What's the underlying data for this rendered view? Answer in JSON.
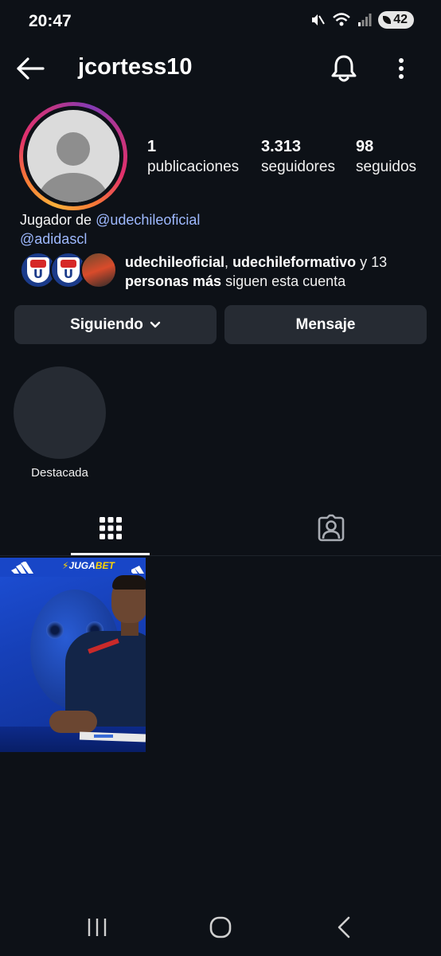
{
  "status_bar": {
    "time": "20:47",
    "battery": "42"
  },
  "profile": {
    "username": "jcortess10",
    "stats": [
      {
        "value": "1",
        "label": "publicaciones"
      },
      {
        "value": "3.313",
        "label": "seguidores"
      },
      {
        "value": "98",
        "label": "seguidos"
      }
    ],
    "bio": {
      "prefix": "Jugador de ",
      "mention_1": "@udechileoficial",
      "mention_2": "@adidascl"
    },
    "followed_by": {
      "name_1": "udechileoficial",
      "separator": ", ",
      "name_2": "udechileformativo",
      "connector": " y 13",
      "others": "personas más",
      "suffix": " siguen esta cuenta"
    }
  },
  "actions": {
    "following_label": "Siguiendo",
    "message_label": "Mensaje"
  },
  "highlights": [
    {
      "label": "Destacada"
    }
  ],
  "post": {
    "sponsor_prefix": "JUGA",
    "sponsor_suffix": "BET"
  },
  "icons": {
    "back": "arrow-left-icon",
    "notifications": "bell-icon",
    "more": "more-vertical-icon",
    "dropdown": "chevron-down-icon",
    "grid_tab": "grid-icon",
    "tagged_tab": "tagged-person-icon",
    "nav_recents": "recents-icon",
    "nav_home": "home-icon",
    "nav_back": "back-icon"
  },
  "colors": {
    "background": "#0d1117",
    "button": "#262b33",
    "mention": "#9eb9ff"
  }
}
